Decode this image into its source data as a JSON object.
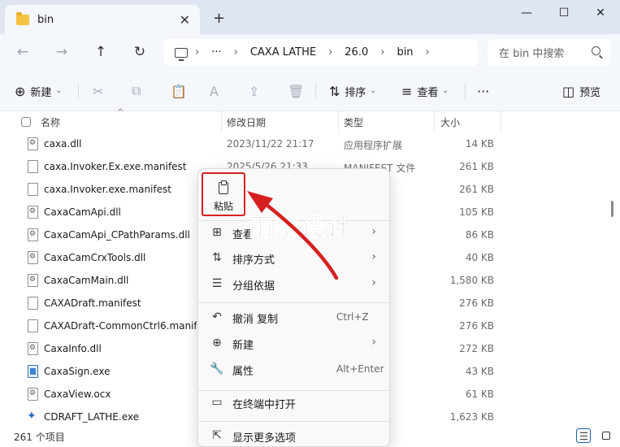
{
  "tab": {
    "title": "bin",
    "close_glyph": "✕",
    "new_glyph": "+"
  },
  "window": {
    "minimize": "—",
    "maximize": "☐",
    "close": "✕"
  },
  "nav": {
    "back": "←",
    "forward": "→",
    "up": "↑",
    "refresh": "↻"
  },
  "address": {
    "more": "···",
    "crumbs": [
      "CAXA LATHE",
      "26.0",
      "bin"
    ],
    "sep": "›"
  },
  "search": {
    "placeholder": "在 bin 中搜索"
  },
  "toolbar": {
    "new_label": "新建",
    "sort_label": "排序",
    "view_label": "查看",
    "more_glyph": "···",
    "preview_label": "预览",
    "icons": {
      "new": "⊕",
      "cut": "✂",
      "copy": "⧉",
      "paste": "📋",
      "rename": "A",
      "share": "⇪",
      "delete": "🗑",
      "sort": "⇅",
      "view": "≡",
      "preview": "◫"
    }
  },
  "columns": {
    "name": "名称",
    "date": "修改日期",
    "type": "类型",
    "size": "大小",
    "sort_caret": "^"
  },
  "files": [
    {
      "name": "caxa.dll",
      "date": "2023/11/22 21:17",
      "type": "应用程序扩展",
      "size": "14 KB",
      "icon": "dll-icon"
    },
    {
      "name": "caxa.Invoker.Ex.exe.manifest",
      "date": "2025/5/26 21:33",
      "type": "MANIFEST 文件",
      "size": "261 KB",
      "icon": "file-icon"
    },
    {
      "name": "caxa.Invoker.exe.manifest",
      "date": "",
      "type": "T 文件",
      "size": "261 KB",
      "icon": "file-icon"
    },
    {
      "name": "CaxaCamApi.dll",
      "date": "",
      "type": "广展",
      "size": "105 KB",
      "icon": "dll-icon"
    },
    {
      "name": "CaxaCamApi_CPathParams.dll",
      "date": "",
      "type": "广展",
      "size": "86 KB",
      "icon": "dll-icon"
    },
    {
      "name": "CaxaCamCrxTools.dll",
      "date": "",
      "type": "广展",
      "size": "40 KB",
      "icon": "dll-icon"
    },
    {
      "name": "CaxaCamMain.dll",
      "date": "",
      "type": "广展",
      "size": "1,580 KB",
      "icon": "dll-icon"
    },
    {
      "name": "CAXADraft.manifest",
      "date": "",
      "type": "T 文件",
      "size": "276 KB",
      "icon": "file-icon"
    },
    {
      "name": "CAXADraft-CommonCtrl6.manifest",
      "date": "",
      "type": "T 文件",
      "size": "276 KB",
      "icon": "file-icon"
    },
    {
      "name": "CaxaInfo.dll",
      "date": "",
      "type": "广展",
      "size": "272 KB",
      "icon": "dll-icon"
    },
    {
      "name": "CaxaSign.exe",
      "date": "",
      "type": "",
      "size": "43 KB",
      "icon": "exe-icon"
    },
    {
      "name": "CaxaView.ocx",
      "date": "",
      "type": "件",
      "size": "61 KB",
      "icon": "dll-icon"
    },
    {
      "name": "CDRAFT_LATHE.exe",
      "date": "",
      "type": "",
      "size": "1,623 KB",
      "icon": "cad-icon"
    }
  ],
  "status": {
    "count": "261 个项目"
  },
  "context_menu": {
    "paste_label": "粘贴",
    "items": [
      {
        "icon": "⊞",
        "label": "查看",
        "shortcut": "",
        "arrow": "›"
      },
      {
        "icon": "⇅",
        "label": "排序方式",
        "shortcut": "",
        "arrow": "›"
      },
      {
        "icon": "☰",
        "label": "分组依据",
        "shortcut": "",
        "arrow": "›"
      },
      {
        "icon": "↶",
        "label": "撤消 复制",
        "shortcut": "Ctrl+Z",
        "arrow": ""
      },
      {
        "icon": "⊕",
        "label": "新建",
        "shortcut": "",
        "arrow": "›"
      },
      {
        "icon": "🔧",
        "label": "属性",
        "shortcut": "Alt+Enter",
        "arrow": ""
      },
      {
        "icon": "▭",
        "label": "在终端中打开",
        "shortcut": "",
        "arrow": ""
      },
      {
        "icon": "⇱",
        "label": "显示更多选项",
        "shortcut": "",
        "arrow": ""
      }
    ]
  },
  "watermark": "雨梨设计",
  "colors": {
    "highlight": "#d62020",
    "accent": "#1a5fb4"
  }
}
